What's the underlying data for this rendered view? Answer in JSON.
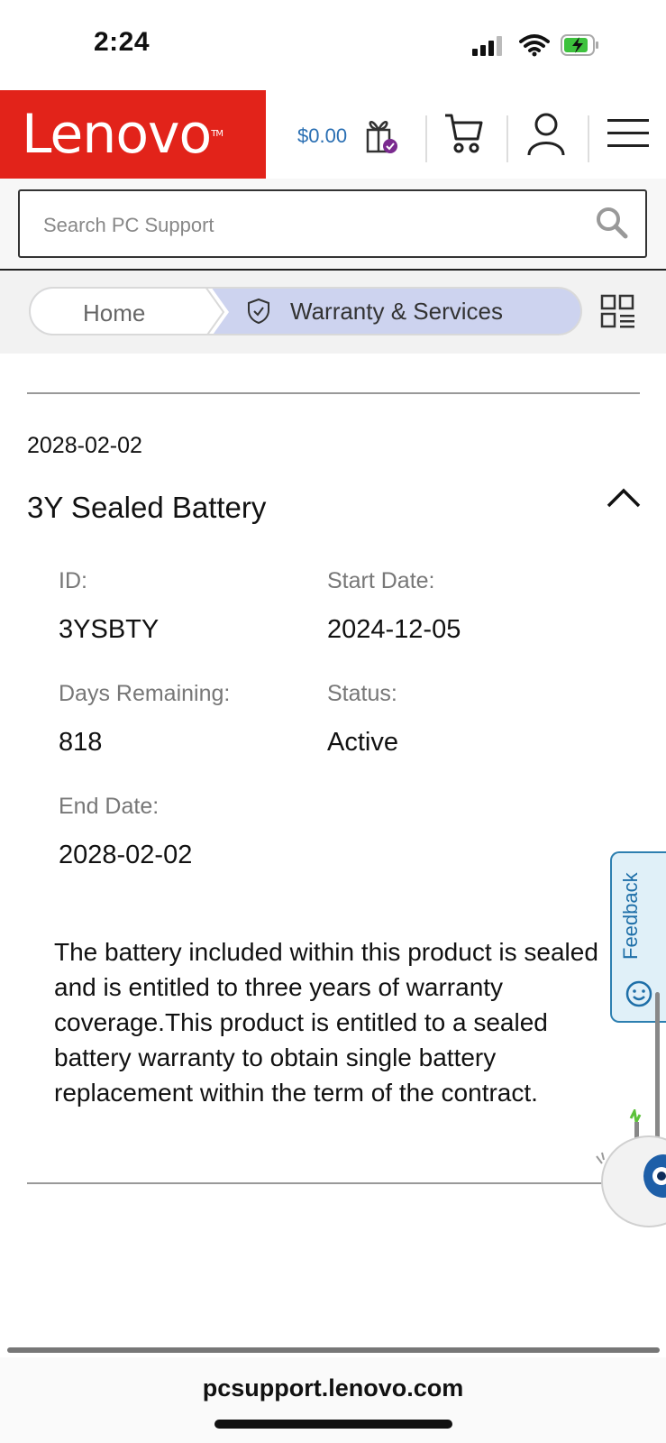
{
  "status_bar": {
    "time": "2:24"
  },
  "header": {
    "logo": "Lenovo",
    "logo_tm": "TM",
    "rewards_amount": "$0.00"
  },
  "search": {
    "placeholder": "Search PC Support"
  },
  "breadcrumb": {
    "home": "Home",
    "current": "Warranty & Services"
  },
  "warranty": {
    "end_date_header": "2028-02-02",
    "title": "3Y Sealed Battery",
    "fields": {
      "id_label": "ID:",
      "id_value": "3YSBTY",
      "start_label": "Start Date:",
      "start_value": "2024-12-05",
      "days_label": "Days Remaining:",
      "days_value": "818",
      "status_label": "Status:",
      "status_value": "Active",
      "end_label": "End Date:",
      "end_value": "2028-02-02"
    },
    "description": "The battery included within this product is sealed and is entitled to three years of warranty coverage.This product is entitled to a sealed battery warranty to obtain single battery replacement within the term of the contract."
  },
  "feedback": {
    "label": "Feedback"
  },
  "browser": {
    "url": "pcsupport.lenovo.com"
  },
  "colors": {
    "brand_red": "#e2231a",
    "link_blue": "#2a6fb3",
    "breadcrumb_active": "#cdd3ef"
  }
}
